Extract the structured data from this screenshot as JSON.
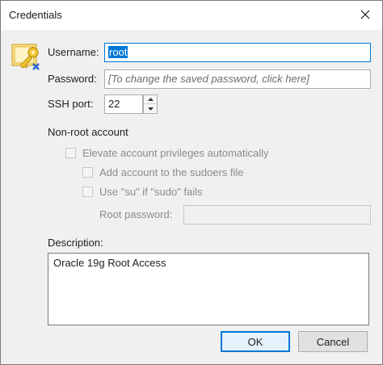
{
  "window": {
    "title": "Credentials"
  },
  "form": {
    "username": {
      "label": "Username:",
      "value": "root"
    },
    "password": {
      "label": "Password:",
      "placeholder": "[To change the saved password, click here]"
    },
    "ssh_port": {
      "label": "SSH port:",
      "value": "22"
    }
  },
  "non_root": {
    "group_label": "Non-root account",
    "elevate_label": "Elevate account privileges automatically",
    "sudoers_label": "Add account to the sudoers file",
    "su_label": "Use \"su\" if \"sudo\" fails",
    "root_password_label": "Root password:"
  },
  "description": {
    "label": "Description:",
    "value": "Oracle 19g Root Access"
  },
  "buttons": {
    "ok": "OK",
    "cancel": "Cancel"
  },
  "icons": {
    "window_icon": "keys-icon",
    "close": "close-icon"
  }
}
